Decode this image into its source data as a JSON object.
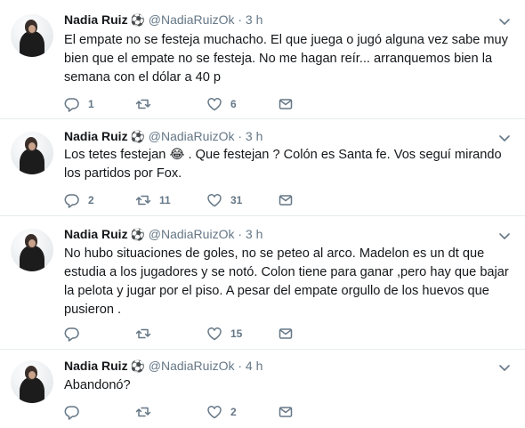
{
  "tweets": [
    {
      "name": "Nadia Ruiz",
      "badge": "⚽",
      "handle": "@NadiaRuizOk",
      "separator": "·",
      "time": "3 h",
      "text": "El empate no se festeja muchacho. El que juega o jugó alguna vez sabe muy bien que el empate no se festeja. No me hagan reír... arranquemos bien la semana con el dólar a 40 p",
      "replies": "1",
      "retweets": "",
      "likes": "6"
    },
    {
      "name": "Nadia Ruiz",
      "badge": "⚽",
      "handle": "@NadiaRuizOk",
      "separator": "·",
      "time": "3 h",
      "text": "Los tetes festejan 😂 . Que festejan ? Colón es Santa fe. Vos seguí mirando los partidos por Fox.",
      "replies": "2",
      "retweets": "11",
      "likes": "31"
    },
    {
      "name": "Nadia Ruiz",
      "badge": "⚽",
      "handle": "@NadiaRuizOk",
      "separator": "·",
      "time": "3 h",
      "text": "No hubo situaciones de goles,  no se peteo al arco. Madelon es un dt que estudia a los jugadores y se notó. Colon tiene para ganar ,pero hay que bajar la pelota y jugar por el piso. A pesar del empate orgullo de los huevos que pusieron .",
      "replies": "",
      "retweets": "",
      "likes": "15"
    },
    {
      "name": "Nadia Ruiz",
      "badge": "⚽",
      "handle": "@NadiaRuizOk",
      "separator": "·",
      "time": "4 h",
      "text": "Abandonó?",
      "replies": "",
      "retweets": "",
      "likes": "2"
    }
  ],
  "icons": {
    "reply": "reply-icon",
    "retweet": "retweet-icon",
    "like": "heart-icon",
    "message": "direct-message-icon",
    "menu": "chevron-down-icon"
  },
  "colors": {
    "icon": "#657786",
    "divider": "#e6ecf0",
    "text": "#14171a"
  }
}
